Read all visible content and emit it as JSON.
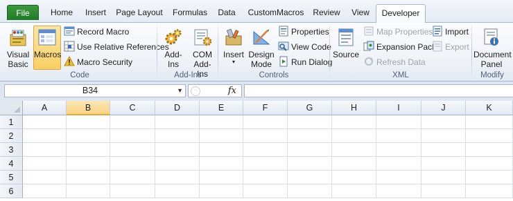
{
  "tabs": [
    {
      "label": "File",
      "kind": "file"
    },
    {
      "label": "Home"
    },
    {
      "label": "Insert"
    },
    {
      "label": "Page Layout"
    },
    {
      "label": "Formulas"
    },
    {
      "label": "Data"
    },
    {
      "label": "CustomMacros"
    },
    {
      "label": "Review"
    },
    {
      "label": "View"
    },
    {
      "label": "Developer",
      "active": true
    }
  ],
  "ribbon": {
    "code": {
      "label": "Code",
      "visual_basic": "Visual\nBasic",
      "macros": "Macros",
      "record_macro": "Record Macro",
      "relative_refs": "Use Relative References",
      "macro_security": "Macro Security"
    },
    "addins": {
      "label": "Add-Ins",
      "add_ins": "Add-Ins",
      "com_add_ins": "COM\nAdd-Ins"
    },
    "controls": {
      "label": "Controls",
      "insert": "Insert",
      "design_mode": "Design\nMode",
      "properties": "Properties",
      "view_code": "View Code",
      "run_dialog": "Run Dialog"
    },
    "xml": {
      "label": "XML",
      "source": "Source",
      "map_properties": "Map Properties",
      "expansion_packs": "Expansion Packs",
      "refresh_data": "Refresh Data",
      "import": "Import",
      "export": "Export"
    },
    "modify": {
      "label": "Modify",
      "document_panel": "Document\nPanel"
    }
  },
  "formula_bar": {
    "name_box": "B34",
    "fx": "fx",
    "formula": ""
  },
  "grid": {
    "columns": [
      "A",
      "B",
      "C",
      "D",
      "E",
      "F",
      "G",
      "H",
      "I",
      "J",
      "K"
    ],
    "selected_column": "B",
    "rows": [
      "1",
      "2",
      "3",
      "4",
      "5",
      "6"
    ]
  },
  "colors": {
    "file_tab": "#1f7a27",
    "selection": "#f9d382",
    "ribbon_border": "#a7b7cf"
  }
}
